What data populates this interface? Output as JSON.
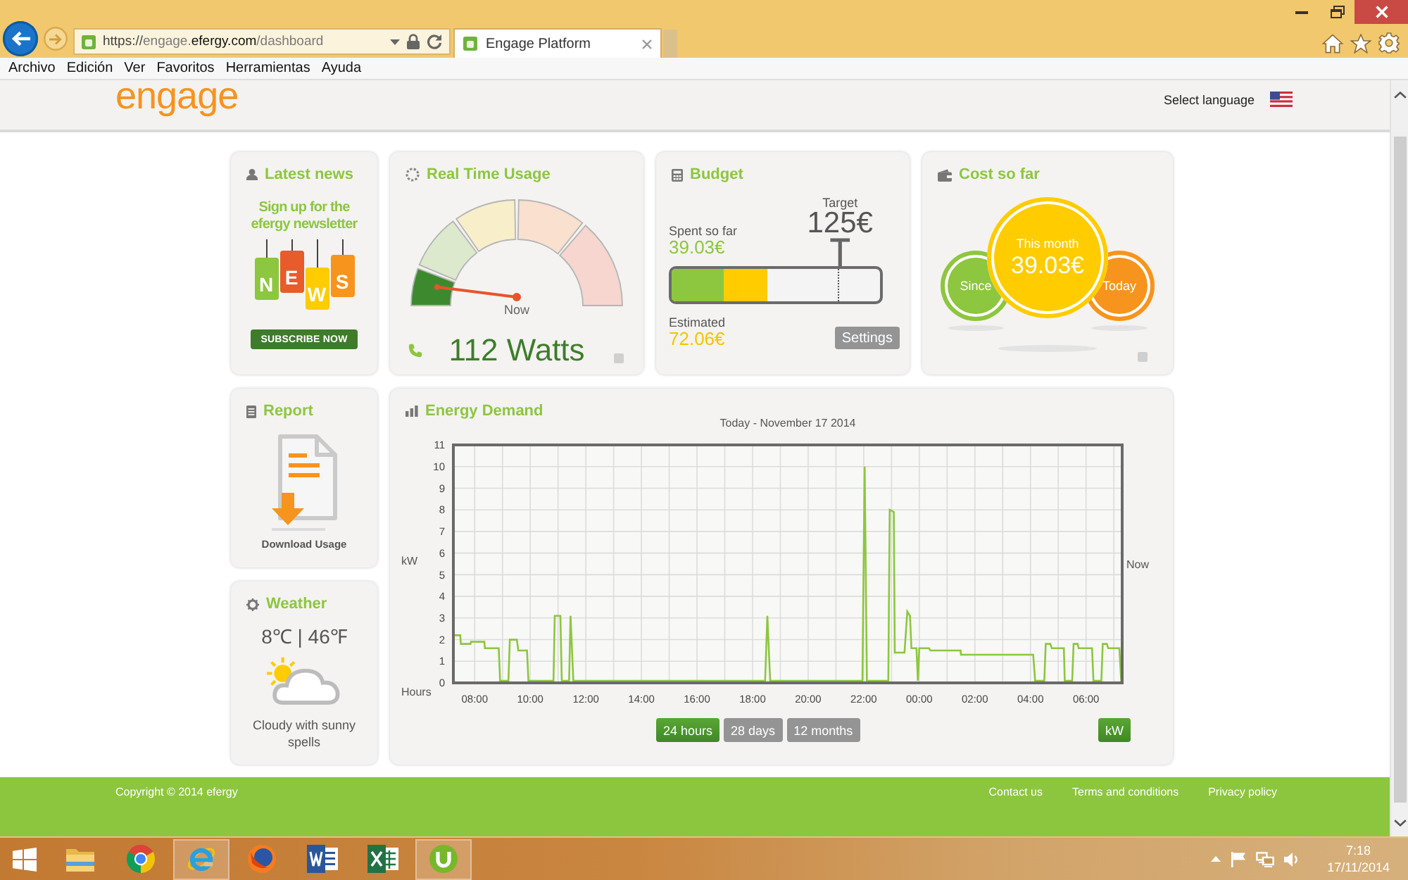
{
  "browser": {
    "url": {
      "scheme": "https://",
      "subdomain": "engage.",
      "domain": "efergy.com",
      "path": "/dashboard"
    },
    "tabs": [
      {
        "title": "Engage Platform",
        "selected": true
      }
    ],
    "menu": [
      "Archivo",
      "Edición",
      "Ver",
      "Favoritos",
      "Herramientas",
      "Ayuda"
    ]
  },
  "header": {
    "logo": "engage",
    "language_label": "Select language"
  },
  "latest_news": {
    "title": "Latest news",
    "headline": "Sign up for the efergy newsletter",
    "tags": [
      {
        "letter": "N",
        "color": "#8dc63f"
      },
      {
        "letter": "E",
        "color": "#e85b2a"
      },
      {
        "letter": "W",
        "color": "#ffcc00"
      },
      {
        "letter": "S",
        "color": "#f7941d"
      }
    ],
    "button": "SUBSCRIBE NOW"
  },
  "realtime": {
    "title": "Real Time Usage",
    "level": 0.04,
    "needle_label": "Now",
    "reading": "112 Watts"
  },
  "budget": {
    "title": "Budget",
    "spent": {
      "label": "Spent so far",
      "value": "39.03€",
      "level": 0.25
    },
    "target": {
      "label": "Target",
      "value": "125€",
      "level": 0.8
    },
    "estimated": {
      "label": "Estimated",
      "value": "72.06€",
      "level": 0.46
    },
    "button": "Settings"
  },
  "cost_so_far": {
    "title": "Cost so far",
    "bubbles": [
      {
        "label": "Since",
        "selected": false,
        "color": "#8dc63f"
      },
      {
        "label": "This month",
        "value": "39.03€",
        "selected": true,
        "color": "#ffcc00"
      },
      {
        "label": "Today",
        "selected": false,
        "color": "#f7941d"
      }
    ]
  },
  "report": {
    "title": "Report",
    "link": "Download Usage"
  },
  "weather": {
    "title": "Weather",
    "temperature": "8℃ | 46℉",
    "summary": "Cloudy with sunny spells"
  },
  "energy_demand": {
    "title": "Energy Demand",
    "chart_data": {
      "type": "line",
      "title": "Today - November 17 2014",
      "xlabel": "Hours",
      "ylabel": "kW",
      "x": [
        "2014-11-16T07:14",
        "2014-11-16T07:29",
        "2014-11-16T07:30",
        "2014-11-16T07:51",
        "2014-11-16T07:52",
        "2014-11-16T08:21",
        "2014-11-16T08:22",
        "2014-11-16T08:52",
        "2014-11-16T08:55",
        "2014-11-16T09:13",
        "2014-11-16T09:16",
        "2014-11-16T09:31",
        "2014-11-16T09:34",
        "2014-11-16T09:53",
        "2014-11-16T09:56",
        "2014-11-16T10:50",
        "2014-11-16T10:53",
        "2014-11-16T11:05",
        "2014-11-16T11:08",
        "2014-11-16T11:24",
        "2014-11-16T11:27",
        "2014-11-16T11:33",
        "2014-11-16T18:27",
        "2014-11-16T18:32",
        "2014-11-16T18:38",
        "2014-11-16T21:57",
        "2014-11-16T22:02",
        "2014-11-16T22:07",
        "2014-11-16T22:53",
        "2014-11-16T22:56",
        "2014-11-16T23:05",
        "2014-11-16T23:07",
        "2014-11-16T23:28",
        "2014-11-16T23:34",
        "2014-11-16T23:40",
        "2014-11-16T23:43",
        "2014-11-16T23:54",
        "2014-11-16T23:57",
        "2014-11-17T00:00",
        "2014-11-17T00:21",
        "2014-11-17T00:24",
        "2014-11-17T01:29",
        "2014-11-17T01:30",
        "2014-11-17T04:06",
        "2014-11-17T04:10",
        "2014-11-17T04:30",
        "2014-11-17T04:33",
        "2014-11-17T04:43",
        "2014-11-17T04:46",
        "2014-11-17T05:12",
        "2014-11-17T05:14",
        "2014-11-17T05:30",
        "2014-11-17T05:33",
        "2014-11-17T05:42",
        "2014-11-17T05:44",
        "2014-11-17T06:13",
        "2014-11-17T06:16",
        "2014-11-17T06:33",
        "2014-11-17T06:36",
        "2014-11-17T06:45",
        "2014-11-17T06:48",
        "2014-11-17T07:12",
        "2014-11-17T07:16",
        "2014-11-17T07:18"
      ],
      "series": [
        {
          "color": "#8dc63f",
          "values": [
            2.2,
            2.2,
            1.8,
            1.8,
            1.9,
            1.9,
            1.6,
            1.6,
            0.1,
            0.1,
            2.0,
            2.0,
            1.5,
            1.5,
            0.1,
            0.1,
            3.1,
            3.1,
            0.1,
            0.1,
            3.1,
            0.1,
            0.1,
            3.1,
            0.1,
            0.1,
            10,
            0.1,
            0.1,
            8.0,
            7.9,
            1.4,
            1.4,
            3.3,
            3.1,
            1.6,
            1.6,
            0.1,
            1.6,
            1.6,
            1.5,
            1.5,
            1.3,
            1.3,
            0.1,
            0.1,
            1.8,
            1.8,
            1.6,
            1.6,
            0.1,
            0.1,
            1.8,
            1.8,
            1.6,
            1.6,
            0.1,
            0.1,
            1.8,
            1.8,
            1.6,
            1.6,
            0.1,
            0.1
          ]
        }
      ],
      "xlim": [
        "2014-11-16T07:14",
        "2014-11-17T07:18"
      ],
      "ylim": [
        0,
        11
      ],
      "xticks": [
        {
          "value": "2014-11-16T08:00",
          "label": "08:00"
        },
        {
          "value": "2014-11-16T10:00",
          "label": "10:00"
        },
        {
          "value": "2014-11-16T12:00",
          "label": "12:00"
        },
        {
          "value": "2014-11-16T14:00",
          "label": "14:00"
        },
        {
          "value": "2014-11-16T16:00",
          "label": "16:00"
        },
        {
          "value": "2014-11-16T18:00",
          "label": "18:00"
        },
        {
          "value": "2014-11-16T20:00",
          "label": "20:00"
        },
        {
          "value": "2014-11-16T22:00",
          "label": "22:00"
        },
        {
          "value": "2014-11-17T00:00",
          "label": "00:00"
        },
        {
          "value": "2014-11-17T02:00",
          "label": "02:00"
        },
        {
          "value": "2014-11-17T04:00",
          "label": "04:00"
        },
        {
          "value": "2014-11-17T06:00",
          "label": "06:00"
        }
      ],
      "yticks": [
        0,
        1,
        2,
        3,
        4,
        5,
        6,
        7,
        8,
        9,
        10,
        11
      ],
      "grid": true,
      "annotations": [
        {
          "text": "Now"
        }
      ]
    },
    "ranges": [
      {
        "label": "24 hours",
        "selected": true
      },
      {
        "label": "28 days",
        "selected": false
      },
      {
        "label": "12 months",
        "selected": false
      }
    ],
    "unit_button": "kW"
  },
  "footer": {
    "copyright": "Copyright © 2014 efergy",
    "links": [
      "Contact us",
      "Terms and conditions",
      "Privacy policy"
    ]
  },
  "taskbar": {
    "apps": [
      {
        "kind": "explorer",
        "running": false
      },
      {
        "kind": "chrome",
        "running": false
      },
      {
        "kind": "ie",
        "running": true
      },
      {
        "kind": "firefox",
        "running": false
      },
      {
        "kind": "word",
        "running": false
      },
      {
        "kind": "excel",
        "running": false
      },
      {
        "kind": "utorrent",
        "running": true
      }
    ],
    "clock": {
      "time": "7:18",
      "date": "17/11/2014"
    }
  }
}
